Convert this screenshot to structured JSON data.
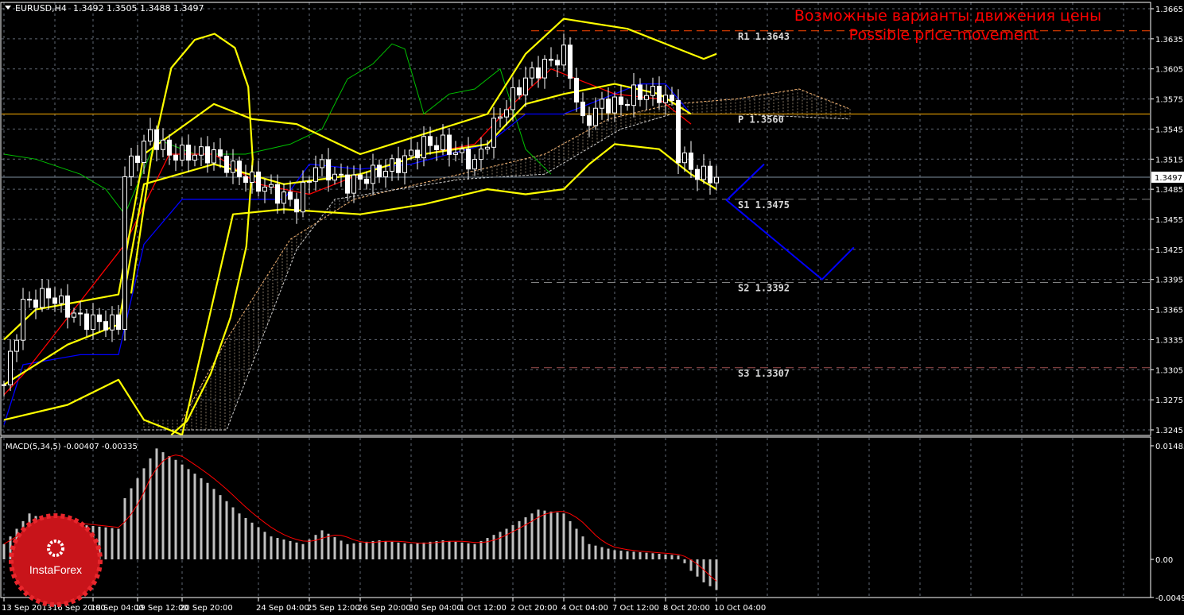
{
  "header": {
    "symbol": "EURUSD,H4",
    "ohlc": "1.3492 1.3505 1.3488 1.3497"
  },
  "annotation": {
    "line1": "Возможные варианты движения цены",
    "line2": "Possible price movement"
  },
  "logo": {
    "text": "InstaForex"
  },
  "colors": {
    "bg": "#000000",
    "grid": "#8a94a6",
    "bull": "#ffffff",
    "bear": "#ffffff",
    "band": "#ffff00",
    "tenkan": "#ff0000",
    "kijun": "#0000ff",
    "chikou": "#00c000",
    "forecast": "#0000ff",
    "pivot": "#ffb000",
    "r1": "#ff4500",
    "s": "#808080",
    "macd_hist": "#c0c0c0",
    "macd_signal": "#ff0000"
  },
  "chart_data": [
    {
      "type": "candlestick",
      "title": "EURUSD,H4",
      "ylim": [
        1.3235,
        1.3672
      ],
      "y_ticks": [
        "1.3665",
        "1.3635",
        "1.3605",
        "1.3575",
        "1.3545",
        "1.3515",
        "1.3485",
        "1.3455",
        "1.3425",
        "1.3395",
        "1.3365",
        "1.3335",
        "1.3305",
        "1.3275",
        "1.3245"
      ],
      "current_price": "1.3497",
      "x_ticks": [
        {
          "bar": 0,
          "label": "13 Sep 2013"
        },
        {
          "bar": 8,
          "label": "16 Sep 20:00"
        },
        {
          "bar": 14,
          "label": "18 Sep 04:00"
        },
        {
          "bar": 21,
          "label": "19 Sep 12:00"
        },
        {
          "bar": 28,
          "label": "20 Sep 20:00"
        },
        {
          "bar": 40,
          "label": "24 Sep 04:00"
        },
        {
          "bar": 48,
          "label": "25 Sep 12:00"
        },
        {
          "bar": 56,
          "label": "26 Sep 20:00"
        },
        {
          "bar": 64,
          "label": "30 Sep 04:00"
        },
        {
          "bar": 72,
          "label": "1 Oct 12:00"
        },
        {
          "bar": 80,
          "label": "2 Oct 20:00"
        },
        {
          "bar": 88,
          "label": "4 Oct 04:00"
        },
        {
          "bar": 96,
          "label": "7 Oct 12:00"
        },
        {
          "bar": 104,
          "label": "8 Oct 20:00"
        },
        {
          "bar": 112,
          "label": "10 Oct 04:00"
        }
      ],
      "bars": 113,
      "close_keypoints": [
        [
          0,
          1.329
        ],
        [
          3,
          1.337
        ],
        [
          7,
          1.338
        ],
        [
          12,
          1.3355
        ],
        [
          18,
          1.335
        ],
        [
          19,
          1.35
        ],
        [
          23,
          1.354
        ],
        [
          26,
          1.352
        ],
        [
          29,
          1.352
        ],
        [
          33,
          1.352
        ],
        [
          37,
          1.35
        ],
        [
          40,
          1.349
        ],
        [
          43,
          1.348
        ],
        [
          46,
          1.347
        ],
        [
          49,
          1.351
        ],
        [
          54,
          1.349
        ],
        [
          58,
          1.35
        ],
        [
          62,
          1.351
        ],
        [
          66,
          1.353
        ],
        [
          69,
          1.353
        ],
        [
          74,
          1.351
        ],
        [
          78,
          1.356
        ],
        [
          82,
          1.3595
        ],
        [
          84,
          1.3605
        ],
        [
          88,
          1.362
        ],
        [
          89,
          1.36
        ],
        [
          91,
          1.355
        ],
        [
          94,
          1.357
        ],
        [
          97,
          1.357
        ],
        [
          99,
          1.358
        ],
        [
          103,
          1.358
        ],
        [
          105,
          1.357
        ],
        [
          106,
          1.352
        ],
        [
          109,
          1.35
        ],
        [
          112,
          1.3497
        ]
      ],
      "indicators": {
        "bb_upper": [
          [
            0,
            1.3335
          ],
          [
            5,
            1.3365
          ],
          [
            18,
            1.338
          ],
          [
            22,
            1.352
          ],
          [
            33,
            1.357
          ],
          [
            39,
            1.3555
          ],
          [
            46,
            1.355
          ],
          [
            56,
            1.352
          ],
          [
            66,
            1.354
          ],
          [
            76,
            1.356
          ],
          [
            82,
            1.362
          ],
          [
            88,
            1.3655
          ],
          [
            98,
            1.3645
          ],
          [
            106,
            1.3625
          ],
          [
            110,
            1.3615
          ],
          [
            112,
            1.362
          ]
        ],
        "bb_middle": [
          [
            0,
            1.329
          ],
          [
            10,
            1.333
          ],
          [
            18,
            1.335
          ],
          [
            22,
            1.349
          ],
          [
            33,
            1.351
          ],
          [
            44,
            1.349
          ],
          [
            56,
            1.35
          ],
          [
            66,
            1.352
          ],
          [
            76,
            1.353
          ],
          [
            82,
            1.357
          ],
          [
            88,
            1.358
          ],
          [
            96,
            1.359
          ],
          [
            103,
            1.358
          ],
          [
            108,
            1.356
          ]
        ],
        "bb_lower": [
          [
            0,
            1.3255
          ],
          [
            10,
            1.327
          ],
          [
            18,
            1.3295
          ],
          [
            22,
            1.3255
          ],
          [
            28,
            1.324
          ],
          [
            36,
            1.346
          ],
          [
            44,
            1.3465
          ],
          [
            56,
            1.346
          ],
          [
            66,
            1.347
          ],
          [
            76,
            1.3485
          ],
          [
            82,
            1.348
          ],
          [
            88,
            1.3485
          ],
          [
            92,
            1.351
          ],
          [
            96,
            1.353
          ],
          [
            103,
            1.3525
          ],
          [
            108,
            1.35
          ],
          [
            112,
            1.3485
          ]
        ],
        "loop": [
          [
            20,
            1.3381
          ],
          [
            23.1,
            1.3515
          ],
          [
            26.3,
            1.3606
          ],
          [
            30,
            1.3634
          ],
          [
            33.1,
            1.364
          ],
          [
            36.3,
            1.3626
          ],
          [
            38.4,
            1.3587
          ],
          [
            39.1,
            1.3515
          ],
          [
            38.1,
            1.3428
          ],
          [
            35.6,
            1.3357
          ],
          [
            32.5,
            1.3301
          ],
          [
            28.8,
            1.3254
          ],
          [
            26.3,
            1.324
          ]
        ],
        "tenkan": [
          [
            0,
            1.328
          ],
          [
            3,
            1.33
          ],
          [
            19,
            1.343
          ],
          [
            26,
            1.352
          ],
          [
            33,
            1.352
          ],
          [
            40,
            1.349
          ],
          [
            48,
            1.348
          ],
          [
            56,
            1.35
          ],
          [
            66,
            1.352
          ],
          [
            74,
            1.353
          ],
          [
            80,
            1.357
          ],
          [
            86,
            1.3605
          ],
          [
            90,
            1.3595
          ],
          [
            96,
            1.358
          ],
          [
            103,
            1.3575
          ],
          [
            108,
            1.355
          ]
        ],
        "kijun": [
          [
            0,
            1.325
          ],
          [
            3,
            1.331
          ],
          [
            12,
            1.332
          ],
          [
            18,
            1.332
          ],
          [
            22,
            1.343
          ],
          [
            28,
            1.3475
          ],
          [
            44,
            1.3475
          ],
          [
            48,
            1.351
          ],
          [
            56,
            1.3505
          ],
          [
            64,
            1.351
          ],
          [
            76,
            1.353
          ],
          [
            82,
            1.356
          ],
          [
            88,
            1.356
          ],
          [
            100,
            1.359
          ],
          [
            104,
            1.359
          ],
          [
            108,
            1.356
          ]
        ],
        "chikou": [
          [
            0,
            1.352
          ],
          [
            5,
            1.3515
          ],
          [
            12,
            1.35
          ],
          [
            16,
            1.3485
          ],
          [
            19,
            1.346
          ],
          [
            24,
            1.3535
          ],
          [
            30,
            1.352
          ],
          [
            38,
            1.352
          ],
          [
            45,
            1.353
          ],
          [
            50,
            1.3545
          ],
          [
            54,
            1.3595
          ],
          [
            58,
            1.361
          ],
          [
            61,
            1.363
          ],
          [
            63,
            1.3625
          ],
          [
            66,
            1.356
          ],
          [
            70,
            1.358
          ],
          [
            74,
            1.3585
          ],
          [
            78,
            1.3605
          ],
          [
            82,
            1.3525
          ],
          [
            86,
            1.35
          ]
        ],
        "span_a": [
          [
            28,
            1.3255
          ],
          [
            35,
            1.3335
          ],
          [
            45,
            1.3435
          ],
          [
            55,
            1.3475
          ],
          [
            65,
            1.349
          ],
          [
            75,
            1.3505
          ],
          [
            85,
            1.352
          ],
          [
            95,
            1.3555
          ],
          [
            105,
            1.357
          ],
          [
            115,
            1.3575
          ],
          [
            125,
            1.3585
          ],
          [
            133,
            1.3565
          ]
        ],
        "span_b": [
          [
            22,
            1.3245
          ],
          [
            35,
            1.3245
          ],
          [
            46,
            1.3425
          ],
          [
            52,
            1.3475
          ],
          [
            62,
            1.3485
          ],
          [
            72,
            1.3495
          ],
          [
            85,
            1.35
          ],
          [
            97,
            1.3545
          ],
          [
            105,
            1.356
          ],
          [
            115,
            1.356
          ],
          [
            133,
            1.3555
          ]
        ],
        "forecast": [
          [
            119.5,
            1.351
          ],
          [
            113.6,
            1.3474
          ],
          [
            128.6,
            1.3395
          ],
          [
            133.6,
            1.3427
          ]
        ]
      },
      "levels": [
        {
          "name": "R1",
          "label": "R1 1.3643",
          "price": 1.3643,
          "style": "r1"
        },
        {
          "name": "P",
          "label": "P 1.3560",
          "price": 1.356,
          "style": "pivot"
        },
        {
          "name": "S1",
          "label": "S1 1.3475",
          "price": 1.3475,
          "style": "s"
        },
        {
          "name": "S2",
          "label": "S2 1.3392",
          "price": 1.3392,
          "style": "s"
        },
        {
          "name": "S3",
          "label": "S3 1.3307",
          "price": 1.3307,
          "style": "s3"
        }
      ]
    },
    {
      "type": "bar",
      "title": "MACD(5,34,5) -0.00407 -0.00335",
      "ylim": [
        -0.00497,
        0.01485
      ],
      "y_ticks": [
        "0.01485",
        "0.00",
        "-0.00497"
      ],
      "hist_keypoints": [
        [
          0,
          0.002
        ],
        [
          4,
          0.006
        ],
        [
          7,
          0.005
        ],
        [
          18,
          0.004
        ],
        [
          19,
          0.008
        ],
        [
          24,
          0.0145
        ],
        [
          27,
          0.013
        ],
        [
          32,
          0.01
        ],
        [
          37,
          0.006
        ],
        [
          42,
          0.003
        ],
        [
          47,
          0.002
        ],
        [
          50,
          0.0038
        ],
        [
          54,
          0.002
        ],
        [
          59,
          0.0025
        ],
        [
          64,
          0.002
        ],
        [
          69,
          0.0025
        ],
        [
          74,
          0.002
        ],
        [
          79,
          0.004
        ],
        [
          84,
          0.0065
        ],
        [
          88,
          0.006
        ],
        [
          92,
          0.002
        ],
        [
          96,
          0.0012
        ],
        [
          102,
          0.0008
        ],
        [
          106,
          0.0005
        ],
        [
          108,
          -0.0015
        ],
        [
          110,
          -0.003
        ],
        [
          112,
          -0.004
        ]
      ]
    }
  ]
}
